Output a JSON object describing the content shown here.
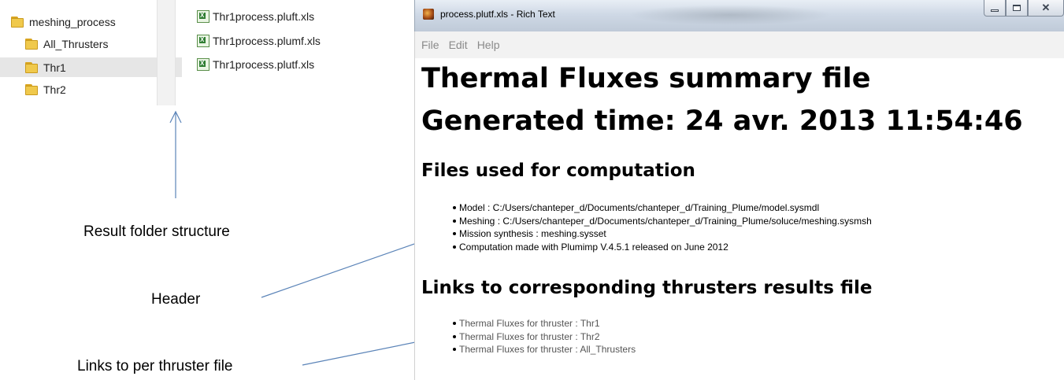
{
  "explorer": {
    "tree": [
      {
        "label": "meshing_process",
        "selected": false
      },
      {
        "label": "All_Thrusters",
        "selected": false
      },
      {
        "label": "Thr1",
        "selected": true
      },
      {
        "label": "Thr2",
        "selected": false
      }
    ],
    "files": [
      {
        "name": "Thr1process.pluft.xls",
        "icon": "excel-file-icon"
      },
      {
        "name": "Thr1process.plumf.xls",
        "icon": "excel-file-icon"
      },
      {
        "name": "Thr1process.plutf.xls",
        "icon": "excel-file-icon"
      }
    ]
  },
  "annotations": {
    "result_folder": "Result folder structure",
    "header": "Header",
    "links": "Links to per thruster file"
  },
  "window": {
    "title": "process.plutf.xls - Rich Text",
    "menu": [
      "File",
      "Edit",
      "Help"
    ],
    "doc": {
      "title_line1": "Thermal Fluxes summary file",
      "title_line2": "Generated time: 24 avr. 2013 11:54:46",
      "section_files": "Files used for computation",
      "files_items": [
        "Model : C:/Users/chanteper_d/Documents/chanteper_d/Training_Plume/model.sysmdl",
        "Meshing : C:/Users/chanteper_d/Documents/chanteper_d/Training_Plume/soluce/meshing.sysmsh",
        "Mission synthesis : meshing.sysset",
        "Computation made with Plumimp V.4.5.1 released on June 2012"
      ],
      "section_links": "Links to corresponding thrusters results file",
      "links_items": [
        "Thermal Fluxes for thruster : Thr1",
        "Thermal Fluxes for thruster : Thr2",
        "Thermal Fluxes for thruster : All_Thrusters"
      ]
    }
  },
  "colors": {
    "arrow": "#5b84b8",
    "folder": "#f0c94c",
    "selected_row": "#e6e6e6",
    "menu_text": "#8a8a8a"
  }
}
